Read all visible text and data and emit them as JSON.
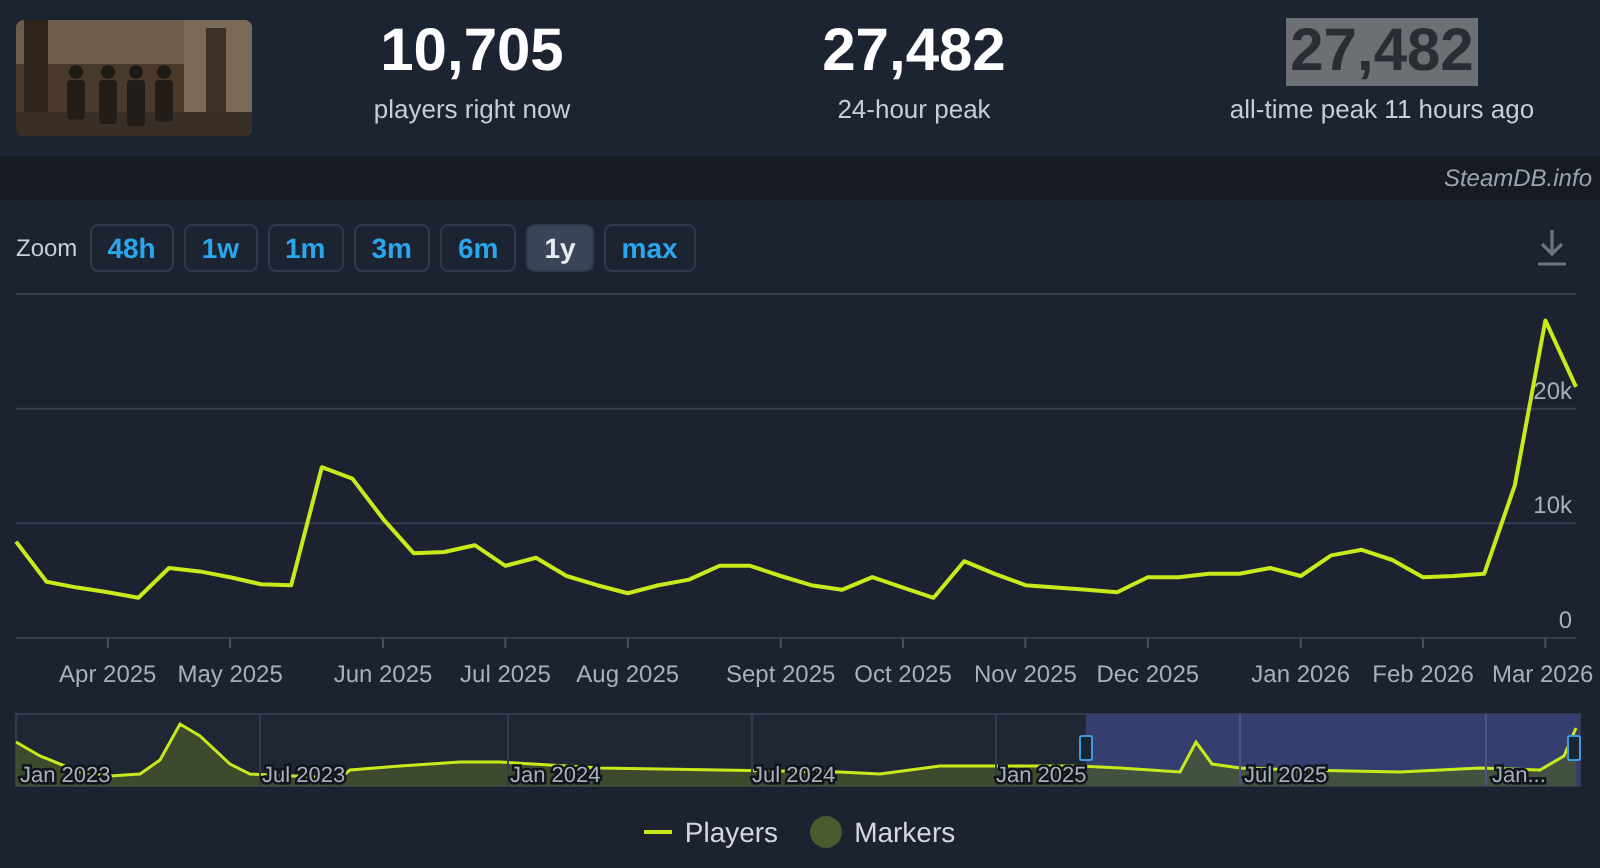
{
  "header": {
    "stats": [
      {
        "value": "10,705",
        "label": "players right now",
        "highlighted": false
      },
      {
        "value": "27,482",
        "label": "24-hour peak",
        "highlighted": false
      },
      {
        "value": "27,482",
        "label": "all-time peak 11 hours ago",
        "highlighted": true
      }
    ]
  },
  "credit": "SteamDB.info",
  "zoom": {
    "label": "Zoom",
    "buttons": [
      {
        "label": "48h",
        "selected": false
      },
      {
        "label": "1w",
        "selected": false
      },
      {
        "label": "1m",
        "selected": false
      },
      {
        "label": "3m",
        "selected": false
      },
      {
        "label": "6m",
        "selected": false
      },
      {
        "label": "1y",
        "selected": true
      },
      {
        "label": "max",
        "selected": false
      }
    ]
  },
  "chart_data": {
    "type": "line",
    "categories": [
      null,
      null,
      null,
      "Apr 2025",
      null,
      null,
      null,
      "May 2025",
      null,
      null,
      null,
      null,
      "Jun 2025",
      null,
      null,
      null,
      "Jul 2025",
      null,
      null,
      null,
      "Aug 2025",
      null,
      null,
      null,
      null,
      "Sept 2025",
      null,
      null,
      null,
      "Oct 2025",
      null,
      null,
      null,
      "Nov 2025",
      null,
      null,
      null,
      "Dec 2025",
      null,
      null,
      null,
      null,
      "Jan 2026",
      null,
      null,
      null,
      "Feb 2026",
      null,
      null,
      null,
      "Mar 2026",
      null
    ],
    "series": [
      {
        "name": "Players",
        "color": "#c8ea1b",
        "values": [
          8400,
          4900,
          4400,
          4000,
          3500,
          6100,
          5800,
          5300,
          4700,
          4600,
          14900,
          13900,
          10400,
          7400,
          7500,
          8100,
          6300,
          7000,
          5400,
          4600,
          3900,
          4600,
          5100,
          6300,
          6300,
          5400,
          4600,
          4200,
          5300,
          4400,
          3500,
          6700,
          5600,
          4600,
          4400,
          4200,
          4000,
          5300,
          5300,
          5600,
          5600,
          6100,
          5400,
          7200,
          7700,
          6800,
          5300,
          5400,
          5600,
          13300,
          27700,
          21900
        ]
      }
    ],
    "ylim": [
      0,
      30000
    ],
    "yticks": [
      {
        "value": 0,
        "label": "0"
      },
      {
        "value": 10000,
        "label": "10k"
      },
      {
        "value": 20000,
        "label": "20k"
      }
    ]
  },
  "navigator": {
    "labels": [
      "Jan 2023",
      "Jul 2023",
      "Jan 2024",
      "Jul 2024",
      "Jan 2025",
      "Jul 2025",
      "Jan..."
    ]
  },
  "legend": [
    {
      "kind": "series"
    },
    {
      "label": "Markers",
      "kind": "dot",
      "color": "#4a5a2c"
    }
  ]
}
